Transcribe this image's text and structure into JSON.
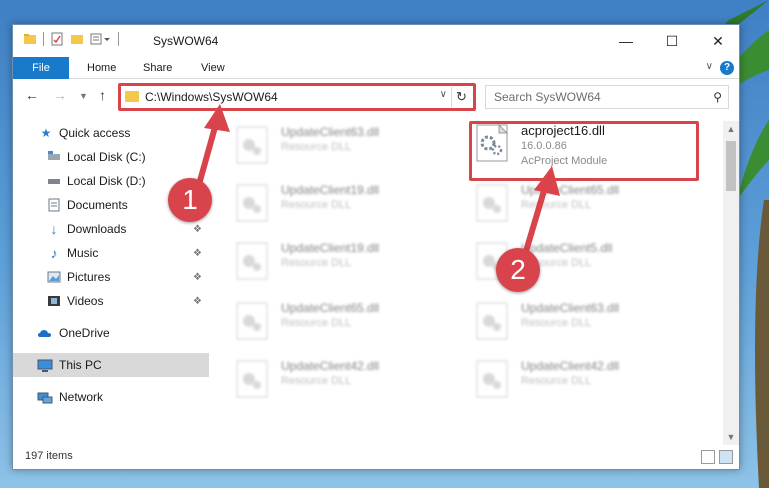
{
  "window": {
    "title": "SysWOW64",
    "minimize_icon": "minimize-icon",
    "maximize_icon": "maximize-icon",
    "close_icon": "close-icon"
  },
  "ribbon": {
    "tabs": [
      "File",
      "Home",
      "Share",
      "View"
    ],
    "help": "?"
  },
  "address": {
    "path": "C:\\Windows\\SysWOW64"
  },
  "search": {
    "placeholder": "Search SysWOW64"
  },
  "sidebar": {
    "items": [
      {
        "label": "Quick access",
        "icon": "star-icon"
      },
      {
        "label": "Local Disk (C:)",
        "icon": "drive-icon"
      },
      {
        "label": "Local Disk (D:)",
        "icon": "drive-icon"
      },
      {
        "label": "Documents",
        "icon": "document-icon"
      },
      {
        "label": "Downloads",
        "icon": "download-icon"
      },
      {
        "label": "Music",
        "icon": "music-icon"
      },
      {
        "label": "Pictures",
        "icon": "pictures-icon"
      },
      {
        "label": "Videos",
        "icon": "videos-icon"
      },
      {
        "label": "OneDrive",
        "icon": "cloud-icon"
      },
      {
        "label": "This PC",
        "icon": "computer-icon"
      },
      {
        "label": "Network",
        "icon": "network-icon"
      }
    ]
  },
  "files": {
    "left": [
      {
        "name": "UpdateClient63.dll",
        "type": "Resource DLL"
      },
      {
        "name": "UpdateClient19.dll",
        "type": "Resource DLL"
      },
      {
        "name": "UpdateClient19.dll",
        "type": "Resource DLL"
      },
      {
        "name": "UpdateClient65.dll",
        "type": "Resource DLL"
      },
      {
        "name": "UpdateClient42.dll",
        "type": "Resource DLL"
      }
    ],
    "highlighted": {
      "name": "acproject16.dll",
      "version": "16.0.0.86",
      "description": "AcProject Module"
    },
    "right": [
      {
        "name": "UpdateClient65.dll",
        "type": "Resource DLL"
      },
      {
        "name": "UpdateClient5.dll",
        "type": "Resource DLL"
      },
      {
        "name": "UpdateClient63.dll",
        "type": "Resource DLL"
      },
      {
        "name": "UpdateClient42.dll",
        "type": "Resource DLL"
      }
    ]
  },
  "status": {
    "items_count": "197 items"
  },
  "annotations": {
    "step1": "1",
    "step2": "2",
    "color": "#d9434b"
  }
}
